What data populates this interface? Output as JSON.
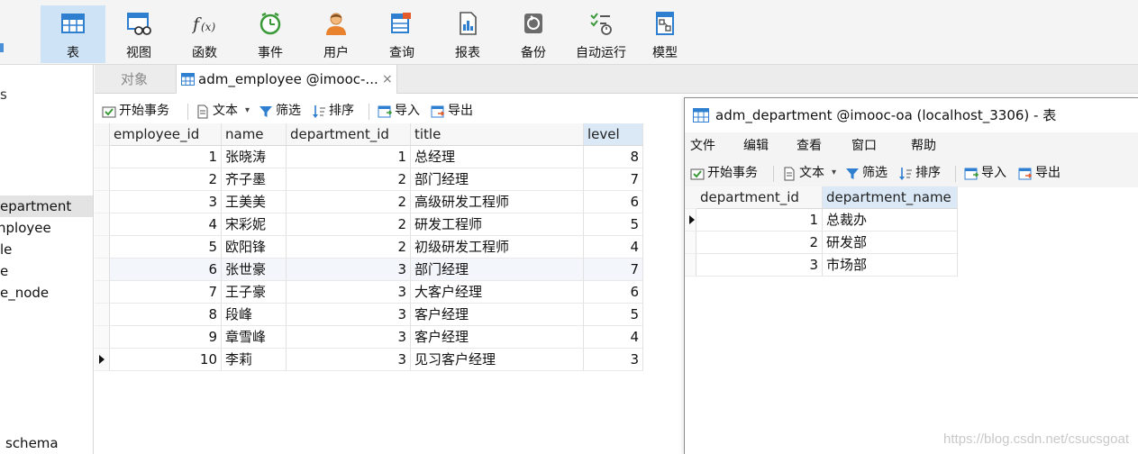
{
  "toolbar": {
    "items": [
      {
        "label": "表",
        "icon": "table-icon"
      },
      {
        "label": "视图",
        "icon": "view-icon"
      },
      {
        "label": "函数",
        "icon": "function-icon"
      },
      {
        "label": "事件",
        "icon": "event-clock-icon"
      },
      {
        "label": "用户",
        "icon": "user-icon"
      },
      {
        "label": "查询",
        "icon": "query-icon"
      },
      {
        "label": "报表",
        "icon": "report-icon"
      },
      {
        "label": "备份",
        "icon": "backup-icon"
      },
      {
        "label": "自动运行",
        "icon": "autorun-icon"
      },
      {
        "label": "模型",
        "icon": "model-icon"
      }
    ],
    "active_index": 0
  },
  "sidebar": {
    "fragments": [
      "s",
      "epartment",
      "nployee",
      "le",
      "e",
      "e_node",
      "schema"
    ],
    "selected": "epartment"
  },
  "tabs": {
    "objects": "对象",
    "employee": "adm_employee @imooc-...",
    "close": "×"
  },
  "subtoolbar": {
    "begin_transaction": "开始事务",
    "text": "文本",
    "text_caret": "▾",
    "filter": "筛选",
    "sort": "排序",
    "import": "导入",
    "export": "导出"
  },
  "employee_table": {
    "columns": [
      "employee_id",
      "name",
      "department_id",
      "title",
      "level"
    ],
    "rows": [
      [
        "1",
        "张晓涛",
        "1",
        "总经理",
        "8"
      ],
      [
        "2",
        "齐子墨",
        "2",
        "部门经理",
        "7"
      ],
      [
        "3",
        "王美美",
        "2",
        "高级研发工程师",
        "6"
      ],
      [
        "4",
        "宋彩妮",
        "2",
        "研发工程师",
        "5"
      ],
      [
        "5",
        "欧阳锋",
        "2",
        "初级研发工程师",
        "4"
      ],
      [
        "6",
        "张世豪",
        "3",
        "部门经理",
        "7"
      ],
      [
        "7",
        "王子豪",
        "3",
        "大客户经理",
        "6"
      ],
      [
        "8",
        "段峰",
        "3",
        "客户经理",
        "5"
      ],
      [
        "9",
        "章雪峰",
        "3",
        "客户经理",
        "4"
      ],
      [
        "10",
        "李莉",
        "3",
        "见习客户经理",
        "3"
      ]
    ],
    "current_row_index": 9,
    "highlight_row_index": 5
  },
  "dept_window": {
    "title": "adm_department @imooc-oa (localhost_3306) - 表",
    "menu": [
      "文件",
      "编辑",
      "查看",
      "窗口",
      "帮助"
    ],
    "columns": [
      "department_id",
      "department_name"
    ],
    "rows": [
      [
        "1",
        "总裁办"
      ],
      [
        "2",
        "研发部"
      ],
      [
        "3",
        "市场部"
      ]
    ],
    "current_row_index": 0
  },
  "watermark": "https://blog.csdn.net/csucsgoat",
  "colors": {
    "toolbar_bg": "#f4f4f4",
    "active_button": "#cfe3f6",
    "header_highlight": "#dbe9f7",
    "accent_blue": "#2f7fd1"
  }
}
